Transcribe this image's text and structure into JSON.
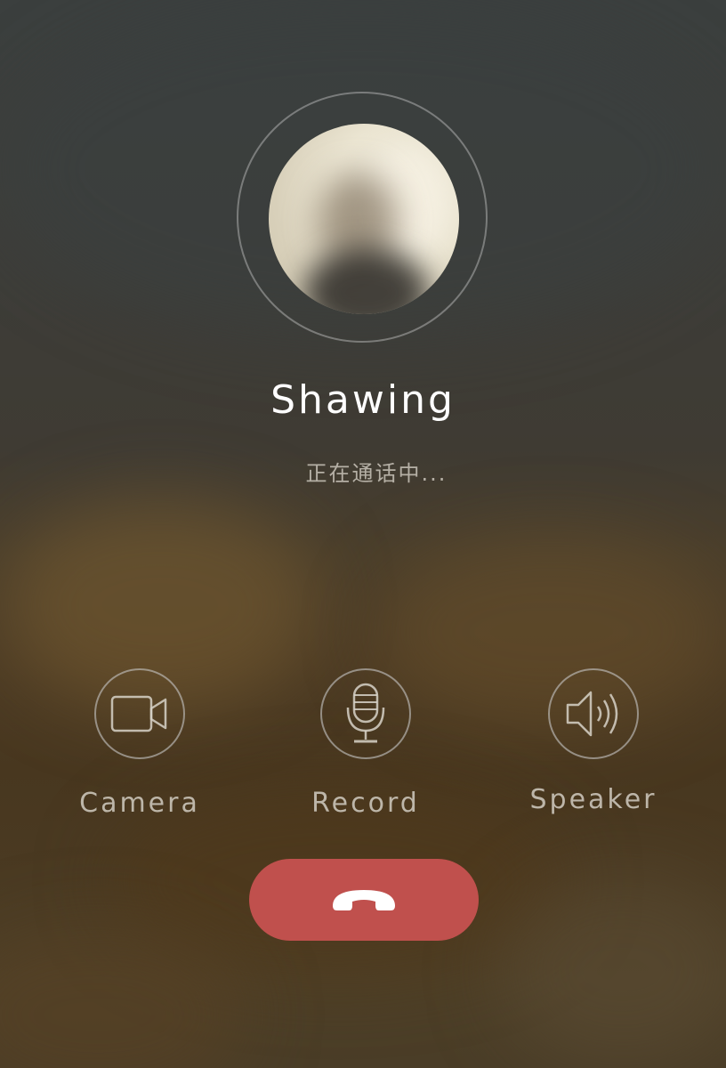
{
  "caller": {
    "name": "Shawing",
    "status": "正在通话中..."
  },
  "actions": [
    {
      "label": "Camera",
      "icon": "video-camera-icon"
    },
    {
      "label": "Record",
      "icon": "microphone-icon"
    },
    {
      "label": "Speaker",
      "icon": "speaker-icon"
    }
  ],
  "hangup": {
    "icon": "hang-up-phone-icon"
  },
  "colors": {
    "hangup": "#c0504d",
    "text_primary": "#ffffff",
    "ring": "#c8c8c8"
  }
}
